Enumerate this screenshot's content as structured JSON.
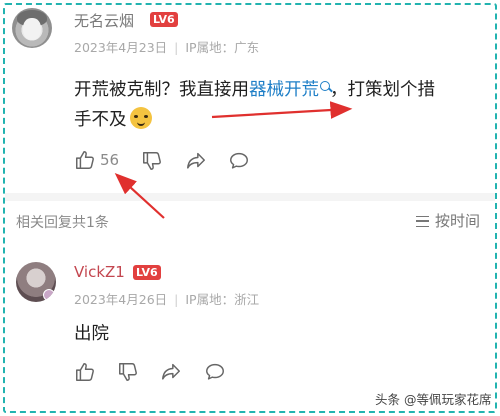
{
  "comment": {
    "username": "无名云烟",
    "level": "LV6",
    "date": "2023年4月23日",
    "ip_location": "IP属地：广东",
    "text_before": "开荒被克制？我直接用",
    "keyword": "器械开荒",
    "text_after_line1": "，打策划个措",
    "text_line2": "手不及",
    "like_count": "56"
  },
  "replies_header": {
    "count_label": "相关回复共1条",
    "sort_label": "按时间"
  },
  "reply": {
    "username": "VickZ1",
    "level": "LV6",
    "date": "2023年4月26日",
    "ip_location": "IP属地：浙江",
    "text": "出院"
  },
  "watermark": "头条 @等佩玩家花席",
  "colors": {
    "frame": "#22b3b0",
    "level_badge": "#e2403f",
    "keyword_link": "#1f7fc7",
    "annotation_arrow": "#e0302e"
  }
}
